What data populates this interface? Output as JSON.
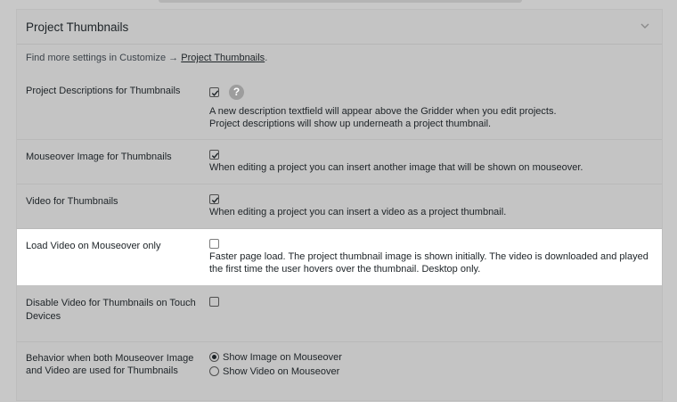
{
  "panel": {
    "title": "Project Thumbnails",
    "info_prefix": "Find more settings in Customize → ",
    "info_link": "Project Thumbnails",
    "info_suffix": "."
  },
  "settings": [
    {
      "label": "Project Descriptions for Thumbnails",
      "checked": true,
      "desc_line1": "A new description textfield will appear above the Gridder when you edit projects.",
      "desc_line2": "Project descriptions will show up underneath a project thumbnail.",
      "help": "?"
    },
    {
      "label": "Mouseover Image for Thumbnails",
      "checked": true,
      "desc_line1": "When editing a project you can insert another image that will be shown on mouseover."
    },
    {
      "label": "Video for Thumbnails",
      "checked": true,
      "desc_line1": "When editing a project you can insert a video as a project thumbnail."
    },
    {
      "label": "Load Video on Mouseover only",
      "checked": false,
      "desc_line1": "Faster page load. The project thumbnail image is shown initially. The video is downloaded and played",
      "desc_line2": "the first time the user hovers over the thumbnail. Desktop only."
    },
    {
      "label_line1": "Disable Video for Thumbnails on Touch",
      "label_line2": "Devices",
      "checked": false
    },
    {
      "label_line1": "Behavior when both Mouseover Image",
      "label_line2": "and Video are used for Thumbnails",
      "options": [
        "Show Image on Mouseover",
        "Show Video on Mouseover"
      ],
      "selected": "Show Image on Mouseover"
    }
  ]
}
